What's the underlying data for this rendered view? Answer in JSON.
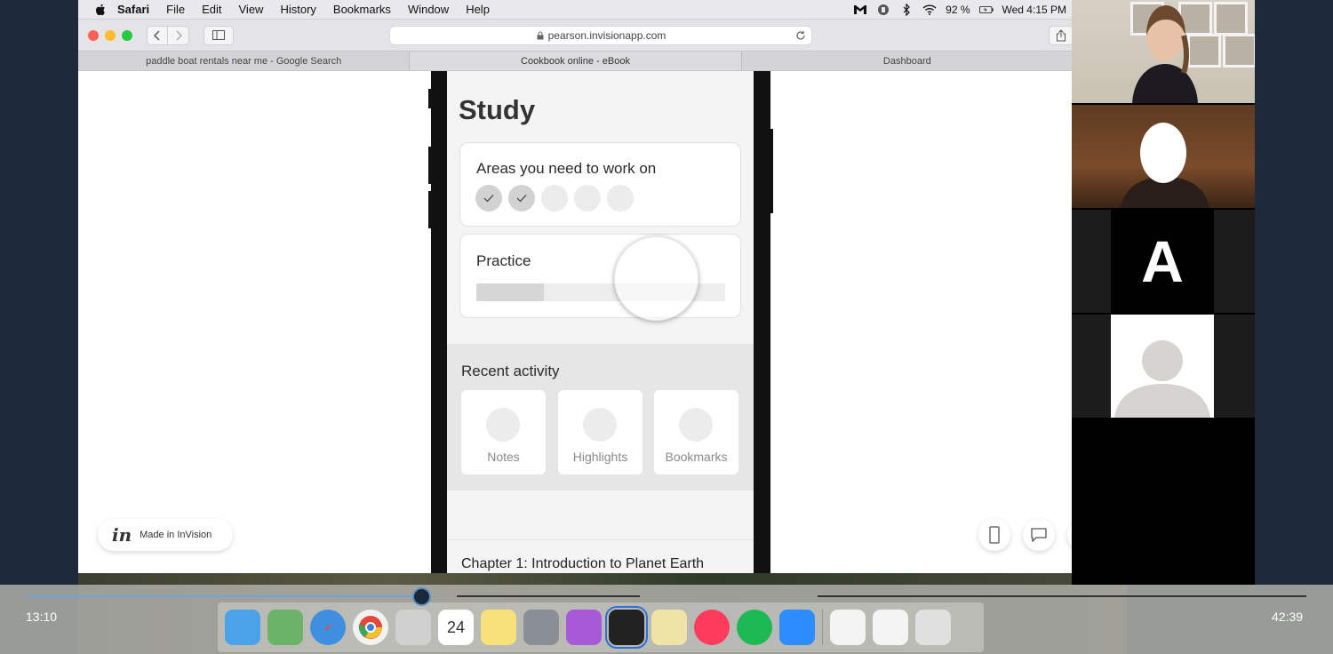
{
  "menubar": {
    "app": "Safari",
    "items": [
      "File",
      "Edit",
      "View",
      "History",
      "Bookmarks",
      "Window",
      "Help"
    ],
    "battery": "92 %",
    "clock": "Wed 4:15 PM"
  },
  "browser": {
    "url": "pearson.invisionapp.com",
    "tabs": [
      "paddle boat rentals near me - Google Search",
      "Cookbook online - eBook",
      "Dashboard"
    ]
  },
  "study": {
    "title": "Study",
    "areas_title": "Areas you need to work on",
    "areas_total": 5,
    "areas_completed": 2,
    "practice_title": "Practice",
    "practice_progress": 0.27,
    "recent_title": "Recent activity",
    "tiles": [
      "Notes",
      "Highlights",
      "Bookmarks"
    ],
    "chapter": "Chapter 1: Introduction to Planet Earth"
  },
  "invision": {
    "logo": "in",
    "label": "Made in InVision"
  },
  "video": {
    "participant_initial": "A"
  },
  "player": {
    "elapsed": "13:10",
    "duration": "42:39",
    "progress": 0.31
  },
  "dock": {
    "calendar_day": "24"
  }
}
